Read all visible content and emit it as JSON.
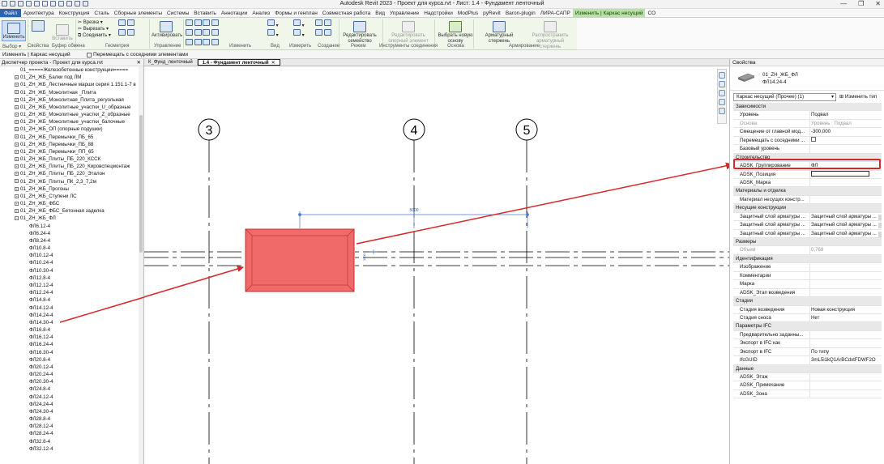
{
  "titlebar": {
    "title": "Autodesk Revit 2023 - Проект для курса.rvt - Лист: 1.4 - Фундамент ленточный",
    "minimize": "—",
    "restore": "❐",
    "close": "✕"
  },
  "ribbon_tabs": [
    "Файл",
    "Архитектура",
    "Конструкция",
    "Сталь",
    "Сборные элементы",
    "Системы",
    "Вставить",
    "Аннотации",
    "Анализ",
    "Формы и генплан",
    "Совместная работа",
    "Вид",
    "Управление",
    "Надстройки",
    "ModPlus",
    "pyRevit",
    "Baron-plugin",
    "ЛИРА-САПР",
    "Изменить | Каркас несущий",
    "CO"
  ],
  "ribbon": {
    "modify": "Изменить",
    "select": "Выбор ▾",
    "properties": "Свойства",
    "paste": "Вставить",
    "clipboard": "Буфер обмена",
    "geometry_items": [
      "Врезка",
      "Вырезать",
      "Соединить"
    ],
    "geometry": "Геометрия",
    "manage": "Управление",
    "activate": "Активировать",
    "modify_panel": "Изменить",
    "view": "Вид",
    "measure": "Измерить",
    "create": "Создание",
    "edit_family": "Редактировать семейство",
    "mode": "Режим",
    "edit_connection": "Редактировать опорный элемент",
    "connection_tools": "Инструменты соединения",
    "select_base": "Выбрать новую основу",
    "base": "Основа",
    "rebar": "Арматурный стержень",
    "distribute_rebar": "Распространить арматурный стержень",
    "reinforcement": "Армирование"
  },
  "options_bar": {
    "context": "Изменить | Каркас несущий",
    "move_with_nearby": "Перемещать с соседними элементами"
  },
  "browser": {
    "title": "Диспетчер проекта - Проект для курса.rvt",
    "close": "✕",
    "items": [
      {
        "t": "01_=====Железобетонные конструкции=====",
        "lvl": 2,
        "pm": ""
      },
      {
        "t": "01_ZH_ЖБ_Балки под ЛМ",
        "lvl": 2,
        "pm": "+"
      },
      {
        "t": "01_ZH_ЖБ_Лестничные марши серия 1.151.1-7 в",
        "lvl": 2,
        "pm": "+"
      },
      {
        "t": "01_ZH_ЖБ_Монолитная _Плита",
        "lvl": 2,
        "pm": "+"
      },
      {
        "t": "01_ZH_ЖБ_Монолитная_Плита_регуольная",
        "lvl": 2,
        "pm": "+"
      },
      {
        "t": "01_ZH_ЖБ_Монолитные_участки_U_образные",
        "lvl": 2,
        "pm": "+"
      },
      {
        "t": "01_ZH_ЖБ_Монолитные_участки_Z_образные",
        "lvl": 2,
        "pm": "+"
      },
      {
        "t": "01_ZH_ЖБ_Монолитные_участки_балочные",
        "lvl": 2,
        "pm": "+"
      },
      {
        "t": "01_ZH_ЖБ_ОП (опорные подушки)",
        "lvl": 2,
        "pm": "+"
      },
      {
        "t": "01_ZH_ЖБ_Перемычки_ПБ_65",
        "lvl": 2,
        "pm": "+"
      },
      {
        "t": "01_ZH_ЖБ_Перемычки_ПБ_88",
        "lvl": 2,
        "pm": "+"
      },
      {
        "t": "01_ZH_ЖБ_Перемычки_ПП_65",
        "lvl": 2,
        "pm": "+"
      },
      {
        "t": "01_ZH_ЖБ_Плиты_ПБ_220_КССК",
        "lvl": 2,
        "pm": "+"
      },
      {
        "t": "01_ZH_ЖБ_Плиты_ПБ_220_Кировспецмонтаж",
        "lvl": 2,
        "pm": "+"
      },
      {
        "t": "01_ZH_ЖБ_Плиты_ПБ_220_Эталон",
        "lvl": 2,
        "pm": "+"
      },
      {
        "t": "01_ZH_ЖБ_Плиты_ПК_2,3_7,2м",
        "lvl": 2,
        "pm": "+"
      },
      {
        "t": "01_ZH_ЖБ_Прогоны",
        "lvl": 2,
        "pm": "+"
      },
      {
        "t": "01_ZH_ЖБ_Ступени ЛС",
        "lvl": 2,
        "pm": "+"
      },
      {
        "t": "01_ZH_ЖБ_ФБС",
        "lvl": 2,
        "pm": "+"
      },
      {
        "t": "01_ZH_ЖБ_ФБС_Бетонная заделка",
        "lvl": 2,
        "pm": "+"
      },
      {
        "t": "01_ZH_ЖБ_ФЛ",
        "lvl": 2,
        "pm": "−"
      },
      {
        "t": "ФЛ6.12-4",
        "lvl": 3,
        "pm": ""
      },
      {
        "t": "ФЛ6.24-4",
        "lvl": 3,
        "pm": ""
      },
      {
        "t": "ФЛ8.24-4",
        "lvl": 3,
        "pm": ""
      },
      {
        "t": "ФЛ10.8-4",
        "lvl": 3,
        "pm": ""
      },
      {
        "t": "ФЛ10.12-4",
        "lvl": 3,
        "pm": ""
      },
      {
        "t": "ФЛ10.24-4",
        "lvl": 3,
        "pm": ""
      },
      {
        "t": "ФЛ10.30-4",
        "lvl": 3,
        "pm": ""
      },
      {
        "t": "ФЛ12.8-4",
        "lvl": 3,
        "pm": ""
      },
      {
        "t": "ФЛ12.12-4",
        "lvl": 3,
        "pm": ""
      },
      {
        "t": "ФЛ12.24-4",
        "lvl": 3,
        "pm": ""
      },
      {
        "t": "ФЛ14.8-4",
        "lvl": 3,
        "pm": ""
      },
      {
        "t": "ФЛ14.12-4",
        "lvl": 3,
        "pm": ""
      },
      {
        "t": "ФЛ14.24-4",
        "lvl": 3,
        "pm": ""
      },
      {
        "t": "ФЛ14.30-4",
        "lvl": 3,
        "pm": ""
      },
      {
        "t": "ФЛ16.8-4",
        "lvl": 3,
        "pm": ""
      },
      {
        "t": "ФЛ16.12-4",
        "lvl": 3,
        "pm": ""
      },
      {
        "t": "ФЛ16.24-4",
        "lvl": 3,
        "pm": ""
      },
      {
        "t": "ФЛ16.30-4",
        "lvl": 3,
        "pm": ""
      },
      {
        "t": "ФЛ20.8-4",
        "lvl": 3,
        "pm": ""
      },
      {
        "t": "ФЛ20.12-4",
        "lvl": 3,
        "pm": ""
      },
      {
        "t": "ФЛ20.24-4",
        "lvl": 3,
        "pm": ""
      },
      {
        "t": "ФЛ20.30-4",
        "lvl": 3,
        "pm": ""
      },
      {
        "t": "ФЛ24.8-4",
        "lvl": 3,
        "pm": ""
      },
      {
        "t": "ФЛ24.12-4",
        "lvl": 3,
        "pm": ""
      },
      {
        "t": "ФЛ24.24-4",
        "lvl": 3,
        "pm": ""
      },
      {
        "t": "ФЛ24.30-4",
        "lvl": 3,
        "pm": ""
      },
      {
        "t": "ФЛ28.8-4",
        "lvl": 3,
        "pm": ""
      },
      {
        "t": "ФЛ28.12-4",
        "lvl": 3,
        "pm": ""
      },
      {
        "t": "ФЛ28.24-4",
        "lvl": 3,
        "pm": ""
      },
      {
        "t": "ФЛ32.8-4",
        "lvl": 3,
        "pm": ""
      },
      {
        "t": "ФЛ32.12-4",
        "lvl": 3,
        "pm": ""
      }
    ]
  },
  "view_tabs": [
    {
      "label": "К_Фунд_ленточный",
      "active": false
    },
    {
      "label": "1.4 - Фундамент ленточный",
      "active": true
    }
  ],
  "view_tab_close": "✕",
  "canvas": {
    "grid_labels": [
      "3",
      "4",
      "5"
    ],
    "dimension": "5000",
    "lock_icon": "⊢⊣",
    "small_dim": "1000"
  },
  "properties": {
    "title": "Свойства",
    "type_line1": "01_ZH_ЖБ_ФЛ",
    "type_line2": "ФЛ14.24-4",
    "selector": "Каркас несущий (Прочее) (1)",
    "selector_dd": "▾",
    "edit_type": "Изменить тип",
    "rows": [
      {
        "sec": "Зависимости"
      },
      {
        "k": "Уровень",
        "v": "Подвал"
      },
      {
        "k": "Основа",
        "v": "Уровень : Подвал",
        "dim": true
      },
      {
        "k": "Смещение от главной мод...",
        "v": "-300,000"
      },
      {
        "k": "Перемещать с соседними ...",
        "v": "",
        "check": true
      },
      {
        "k": "Базовый уровень",
        "v": ""
      },
      {
        "sec": "Строительство"
      },
      {
        "k": "ADSK_Группирование",
        "v": "ФЛ"
      },
      {
        "k": "ADSK_Позиция",
        "v": "",
        "box": true
      },
      {
        "k": "ADSK_Марка",
        "v": ""
      },
      {
        "sec": "Материалы и отделка"
      },
      {
        "k": "Материал несущих констр...",
        "v": ""
      },
      {
        "sec": "Несущие конструкции"
      },
      {
        "k": "Защитный слой арматуры ...",
        "v": "Защитный слой арматуры ..."
      },
      {
        "k": "Защитный слой арматуры ...",
        "v": "Защитный слой арматуры ..."
      },
      {
        "k": "Защитный слой арматуры ...",
        "v": "Защитный слой арматуры ..."
      },
      {
        "sec": "Размеры"
      },
      {
        "k": "Объем",
        "v": "0,769",
        "dim": true
      },
      {
        "sec": "Идентификация"
      },
      {
        "k": "Изображение",
        "v": ""
      },
      {
        "k": "Комментарии",
        "v": ""
      },
      {
        "k": "Марка",
        "v": ""
      },
      {
        "k": "ADSK_Этап возведения",
        "v": ""
      },
      {
        "sec": "Стадии"
      },
      {
        "k": "Стадия возведения",
        "v": "Новая конструкция"
      },
      {
        "k": "Стадия сноса",
        "v": "Нет"
      },
      {
        "sec": "Параметры IFC"
      },
      {
        "k": "Предварительно заданны...",
        "v": ""
      },
      {
        "k": "Экспорт в IFC как",
        "v": ""
      },
      {
        "k": "Экспорт в IFC",
        "v": "По типу"
      },
      {
        "k": "IfcGUID",
        "v": "3mL5i1kQ1ArBCdxtFDWF2O"
      },
      {
        "sec": "Данные"
      },
      {
        "k": "ADSK_Этаж",
        "v": ""
      },
      {
        "k": "ADSK_Примечание",
        "v": ""
      },
      {
        "k": "ADSK_Зона",
        "v": ""
      }
    ]
  },
  "colors": {
    "accent": "#2f63ad",
    "context_tab": "#b8e2a6",
    "highlight": "#d9262a",
    "foundation_fill": "#f06a6a"
  }
}
